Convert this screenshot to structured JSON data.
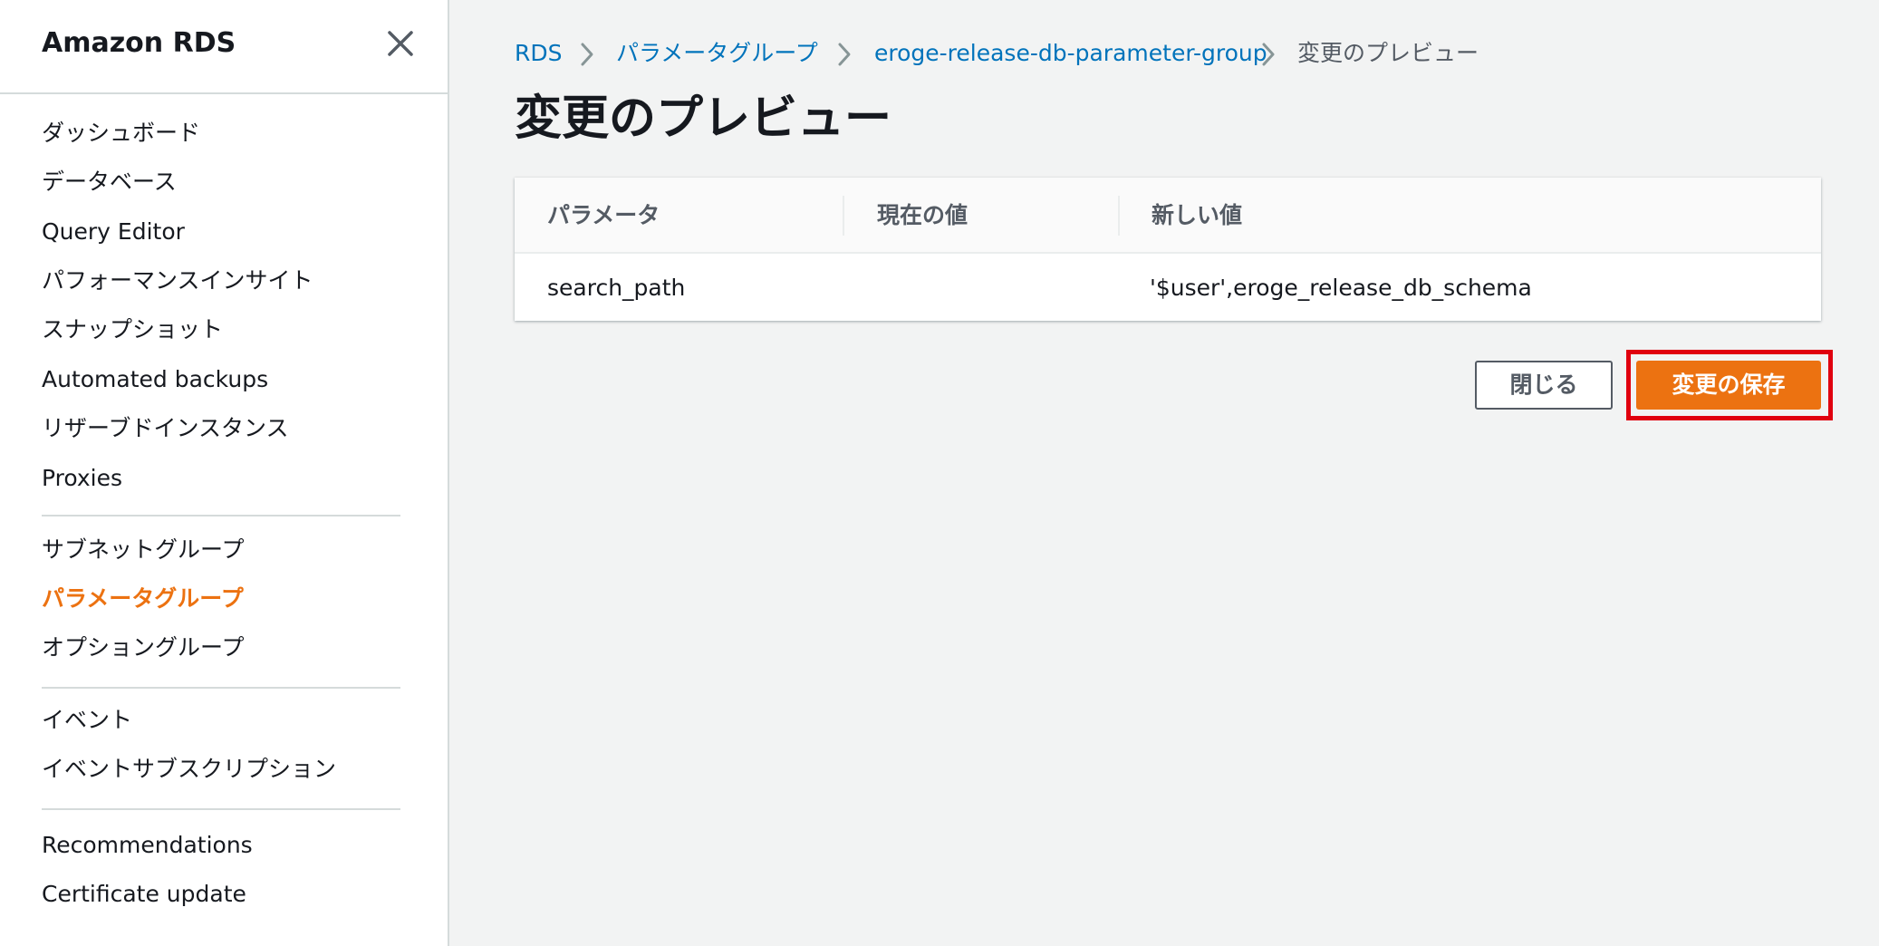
{
  "sidebar": {
    "title": "Amazon RDS",
    "close_icon": "close-icon",
    "items_group1": [
      {
        "label": "ダッシュボード"
      },
      {
        "label": "データベース"
      },
      {
        "label": "Query Editor"
      },
      {
        "label": "パフォーマンスインサイト"
      },
      {
        "label": "スナップショット"
      },
      {
        "label": "Automated backups"
      },
      {
        "label": "リザーブドインスタンス"
      },
      {
        "label": "Proxies"
      }
    ],
    "items_group2": [
      {
        "label": "サブネットグループ"
      },
      {
        "label": "パラメータグループ",
        "active": true
      },
      {
        "label": "オプショングループ"
      }
    ],
    "items_group3": [
      {
        "label": "イベント"
      },
      {
        "label": "イベントサブスクリプション"
      }
    ],
    "items_group4": [
      {
        "label": "Recommendations"
      },
      {
        "label": "Certificate update"
      }
    ],
    "accent_color": "#ec7211"
  },
  "breadcrumb": {
    "items": [
      {
        "label": "RDS"
      },
      {
        "label": "パラメータグループ"
      },
      {
        "label": "eroge-release-db-parameter-group"
      },
      {
        "label": "変更のプレビュー"
      }
    ],
    "separator_icon": "chevron-right-icon",
    "link_color": "#0073bb"
  },
  "page": {
    "title": "変更のプレビュー"
  },
  "table": {
    "columns": [
      "パラメータ",
      "現在の値",
      "新しい値"
    ],
    "rows": [
      {
        "parameter": "search_path",
        "current": "",
        "new": "'$user',eroge_release_db_schema"
      }
    ]
  },
  "actions": {
    "close_label": "閉じる",
    "save_label": "変更の保存",
    "save_color": "#ec7211",
    "highlight_color": "#e0000f"
  }
}
